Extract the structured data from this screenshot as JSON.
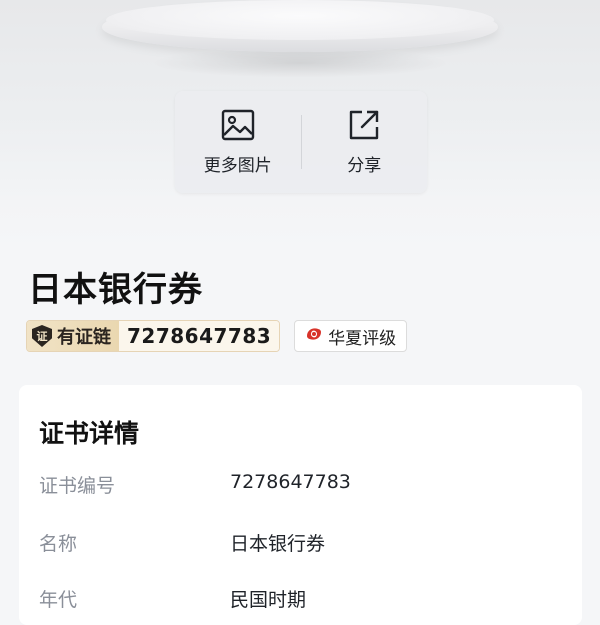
{
  "actions": {
    "more_images": {
      "label": "更多图片",
      "icon": "image-icon"
    },
    "share": {
      "label": "分享",
      "icon": "share-icon"
    }
  },
  "item": {
    "title": "日本银行券",
    "chain_badge": {
      "shield_char": "证",
      "name": "有证链",
      "number": "7278647783"
    },
    "grading_badge": {
      "name": "华夏评级",
      "icon": "huaxia-logo-icon"
    }
  },
  "details": {
    "heading": "证书详情",
    "rows": [
      {
        "key": "证书编号",
        "value": "7278647783"
      },
      {
        "key": "名称",
        "value": "日本银行券"
      },
      {
        "key": "年代",
        "value": "民国时期"
      }
    ]
  },
  "colors": {
    "accent_gold": "#ead7b0",
    "shield_dark": "#2b2520",
    "huaxia_red": "#d8332a"
  }
}
